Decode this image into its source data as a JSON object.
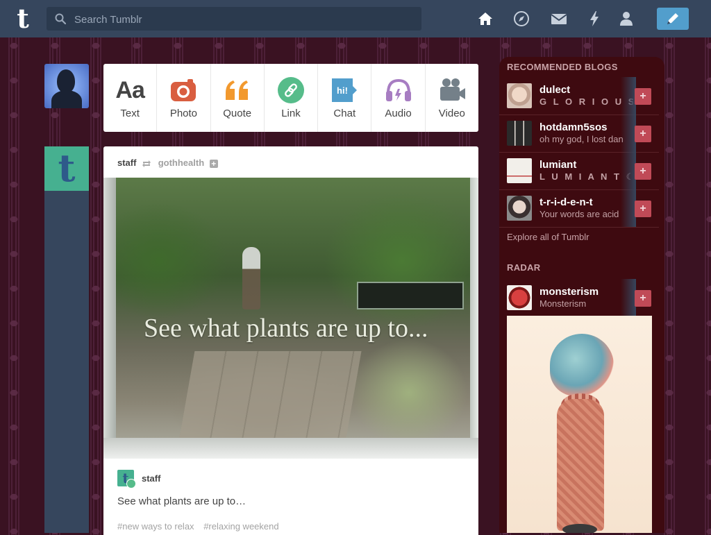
{
  "header": {
    "logo_letter": "t",
    "search_placeholder": "Search Tumblr",
    "nav_icons": [
      "home-icon",
      "explore-compass-icon",
      "inbox-mail-icon",
      "activity-lightning-icon",
      "account-person-icon"
    ],
    "compose_icon": "pencil-icon",
    "colors": {
      "bar": "#36465d",
      "compose": "#529ecc"
    }
  },
  "post_types": [
    {
      "label": "Text",
      "icon": "text-aa-icon",
      "color": "#444444",
      "glyph": "Aa"
    },
    {
      "label": "Photo",
      "icon": "camera-icon",
      "color": "#d95e40"
    },
    {
      "label": "Quote",
      "icon": "quote-icon",
      "color": "#f2992e",
      "glyph": "“"
    },
    {
      "label": "Link",
      "icon": "link-icon",
      "color": "#56bc8a"
    },
    {
      "label": "Chat",
      "icon": "chat-icon",
      "color": "#529ecc",
      "glyph": "hi!"
    },
    {
      "label": "Audio",
      "icon": "headphones-icon",
      "color": "#a77dc2"
    },
    {
      "label": "Video",
      "icon": "video-camera-icon",
      "color": "#748089"
    }
  ],
  "post": {
    "author": "staff",
    "reblogged_from": "gothhealth",
    "image_caption": "See what plants are up to...",
    "footer_author": "staff",
    "body": "See what plants are up to…",
    "tags": [
      "#new ways to relax",
      "#relaxing weekend"
    ]
  },
  "sidebar": {
    "recommended_title": "RECOMMENDED BLOGS",
    "blogs": [
      {
        "name": "dulect",
        "desc": "G L O R I O U S",
        "avatar_color": "#d9c4b8"
      },
      {
        "name": "hotdamn5sos",
        "desc": "oh my god, I lost dan",
        "avatar_color": "#9ab0c8"
      },
      {
        "name": "lumiant",
        "desc": "L U M I A N T ☾",
        "avatar_color": "#e8e4e0"
      },
      {
        "name": "t-r-i-d-e-n-t",
        "desc": "Your words are acid",
        "avatar_color": "#8a8a8a"
      }
    ],
    "explore_label": "Explore all of Tumblr",
    "radar_title": "RADAR",
    "radar_blog": {
      "name": "monsterism",
      "desc": "Monsterism",
      "avatar_color": "#b02a2a"
    },
    "colors": {
      "panel": "#3e0a10",
      "follow_button": "#c04a57"
    }
  }
}
